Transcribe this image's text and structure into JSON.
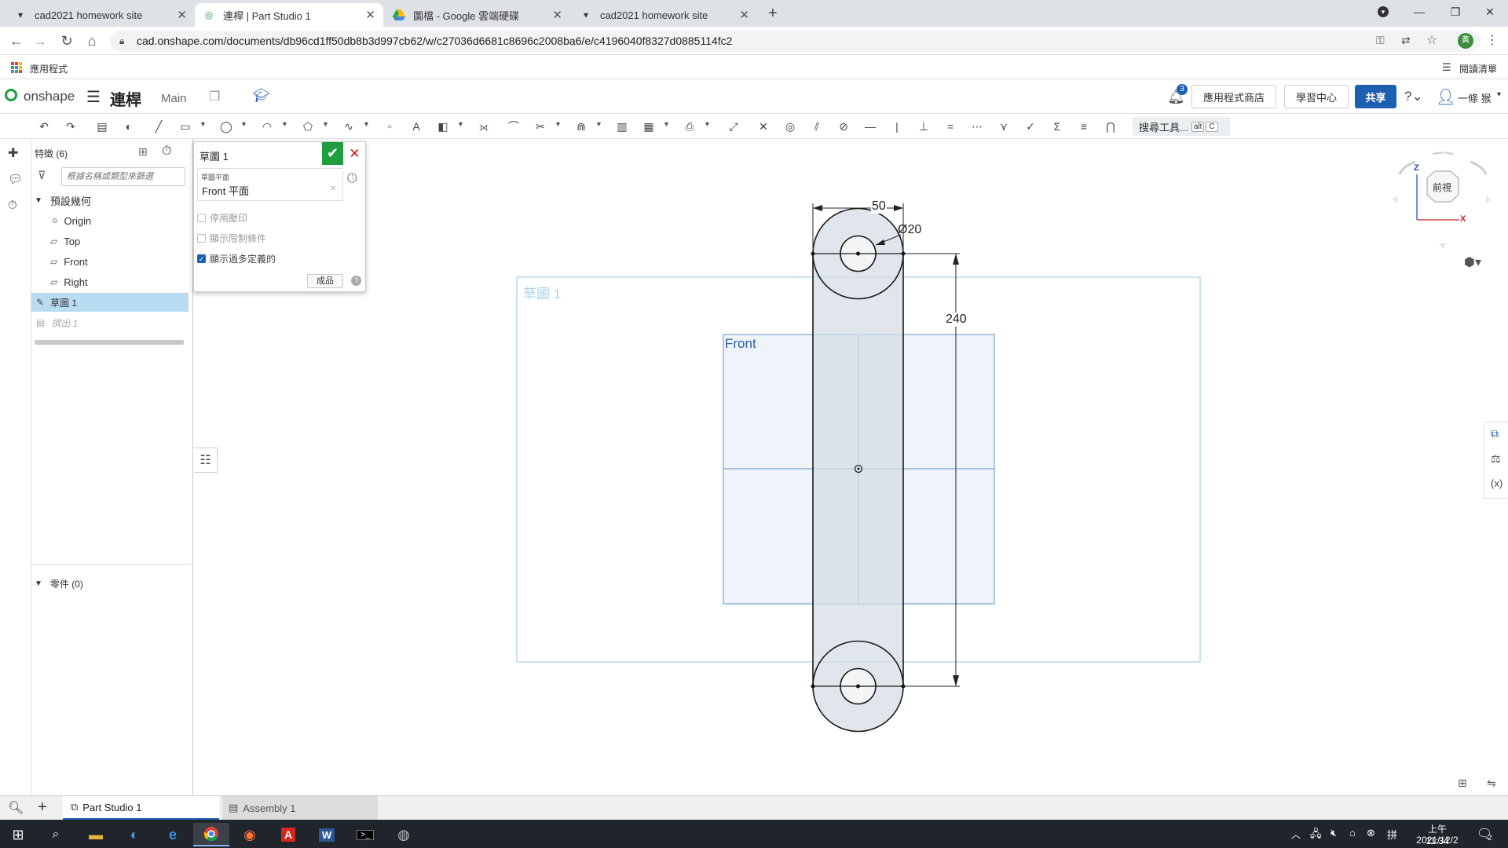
{
  "browser": {
    "tabs": [
      {
        "label": "cad2021 homework site",
        "active": false
      },
      {
        "label": "連桿 | Part Studio 1",
        "active": true
      },
      {
        "label": "圖檔 - Google 雲端硬碟",
        "active": false
      },
      {
        "label": "cad2021 homework site",
        "active": false
      }
    ],
    "url": "cad.onshape.com/documents/db96cd1ff50db8b3d997cb62/w/c27036d6681c8696c2008ba6/e/c4196040f8327d0885114fc2",
    "bookmarks": {
      "apps": "應用程式",
      "reading_list": "閱讀清單"
    }
  },
  "app": {
    "logo": "onshape",
    "doc_title": "連桿",
    "branch": "Main",
    "notification_count": "3",
    "app_store": "應用程式商店",
    "learning_center": "學習中心",
    "share": "共享",
    "user": "一條 猴",
    "search_tools": "搜尋工具...",
    "shortcut_alt": "alt",
    "shortcut_c": "C"
  },
  "feature_panel": {
    "header": "特徵 (6)",
    "filter_placeholder": "根據名稱或類型來篩選",
    "default_geometry": "預設幾何",
    "origin": "Origin",
    "top": "Top",
    "front": "Front",
    "right": "Right",
    "sketch": "草圖 1",
    "extrude": "擠出 1",
    "parts": "零件 (0)"
  },
  "sketch_dialog": {
    "title": "草圖 1",
    "plane_label": "草圖平面",
    "plane_value": "Front 平面",
    "opt_disable_imprint": "停用壓印",
    "opt_show_constraints": "顯示限制條件",
    "opt_show_overdefined": "顯示過多定義的",
    "show_overdefined_checked": true,
    "finish": "成品"
  },
  "canvas": {
    "sketch_label": "草圖 1",
    "plane_label": "Front",
    "dim_width": "50",
    "dim_diameter": "Ø20",
    "dim_length": "240",
    "view_cube_label": "前視",
    "axis_z": "Z",
    "axis_x": "X"
  },
  "bottom_tabs": {
    "part_studio": "Part Studio 1",
    "assembly": "Assembly 1"
  },
  "taskbar": {
    "time": "上午 11:34",
    "date": "2021/12/2",
    "notif_count": "2"
  },
  "colors": {
    "onshape_blue": "#1d5fb0",
    "accent_green": "#1e9e3e",
    "sketch_blue": "#5ba6d8",
    "taskbar": "#20242b"
  }
}
